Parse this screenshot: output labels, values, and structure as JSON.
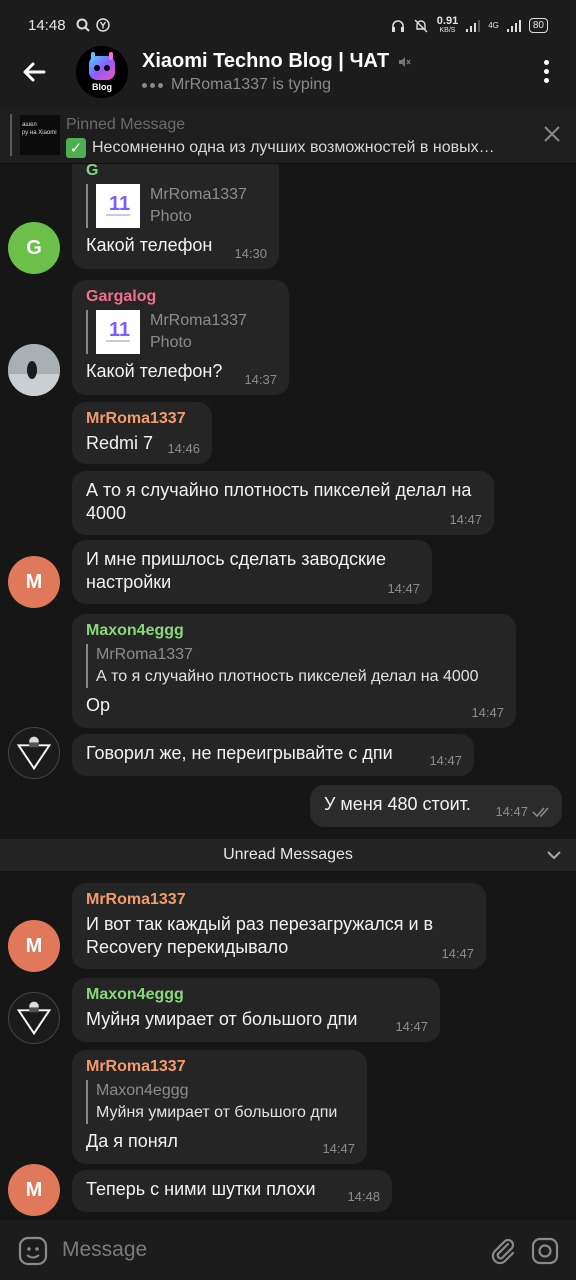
{
  "status_bar": {
    "time": "14:48",
    "net_speed_value": "0.91",
    "net_speed_unit": "KB/S",
    "network": "4G",
    "battery": "80"
  },
  "header": {
    "title": "Xiaomi Techno Blog | ЧАТ",
    "status": "MrRoma1337 is typing",
    "avatar_label": "Blog"
  },
  "pinned": {
    "label": "Pinned Message",
    "text": "Несомненно одна из лучших возможностей в новых…",
    "thumb_line1": "ашел",
    "thumb_line2": "ру на Xiaomi"
  },
  "messages": [
    {
      "sender": "G",
      "reply_name": "MrRoma1337",
      "reply_text": "Photo",
      "text": "Какой телефон",
      "time": "14:30",
      "avatar": "G"
    },
    {
      "sender": "Gargalog",
      "reply_name": "MrRoma1337",
      "reply_text": "Photo",
      "text": "Какой телефон?",
      "time": "14:37"
    },
    {
      "sender": "MrRoma1337",
      "text": "Redmi 7",
      "time": "14:46"
    },
    {
      "text": "А то я случайно плотность пикселей делал на 4000",
      "time": "14:47"
    },
    {
      "text": "И мне пришлось сделать заводские настройки",
      "time": "14:47",
      "avatar": "M"
    },
    {
      "sender": "Maxon4eggg",
      "reply_name": "MrRoma1337",
      "reply_text": "А то я случайно плотность пикселей делал на 4000",
      "text": "Ор",
      "time": "14:47"
    },
    {
      "text": "Говорил же, не переигрывайте с дпи",
      "time": "14:47"
    },
    {
      "text": "У меня 480 стоит.",
      "time": "14:47"
    },
    {
      "sender": "MrRoma1337",
      "text": "И вот так каждый раз перезагружался и в Recovery перекидывало",
      "time": "14:47",
      "avatar": "M"
    },
    {
      "sender": "Maxon4eggg",
      "text": "Муйня умирает от большого дпи",
      "time": "14:47"
    },
    {
      "sender": "MrRoma1337",
      "reply_name": "Maxon4eggg",
      "reply_text": "Муйня умирает от большого дпи",
      "text": "Да я понял",
      "time": "14:47"
    },
    {
      "text": "Теперь с ними шутки плохи",
      "time": "14:48",
      "avatar": "M"
    }
  ],
  "unread_label": "Unread Messages",
  "input": {
    "placeholder": "Message"
  },
  "colors": {
    "sender_g": "#7ed77a",
    "sender_gargalog": "#ef6f8c",
    "sender_mrroma": "#f39b6d",
    "sender_maxon": "#8ad67c",
    "avatar_g": "#6ac049",
    "avatar_m": "#e0785a"
  }
}
